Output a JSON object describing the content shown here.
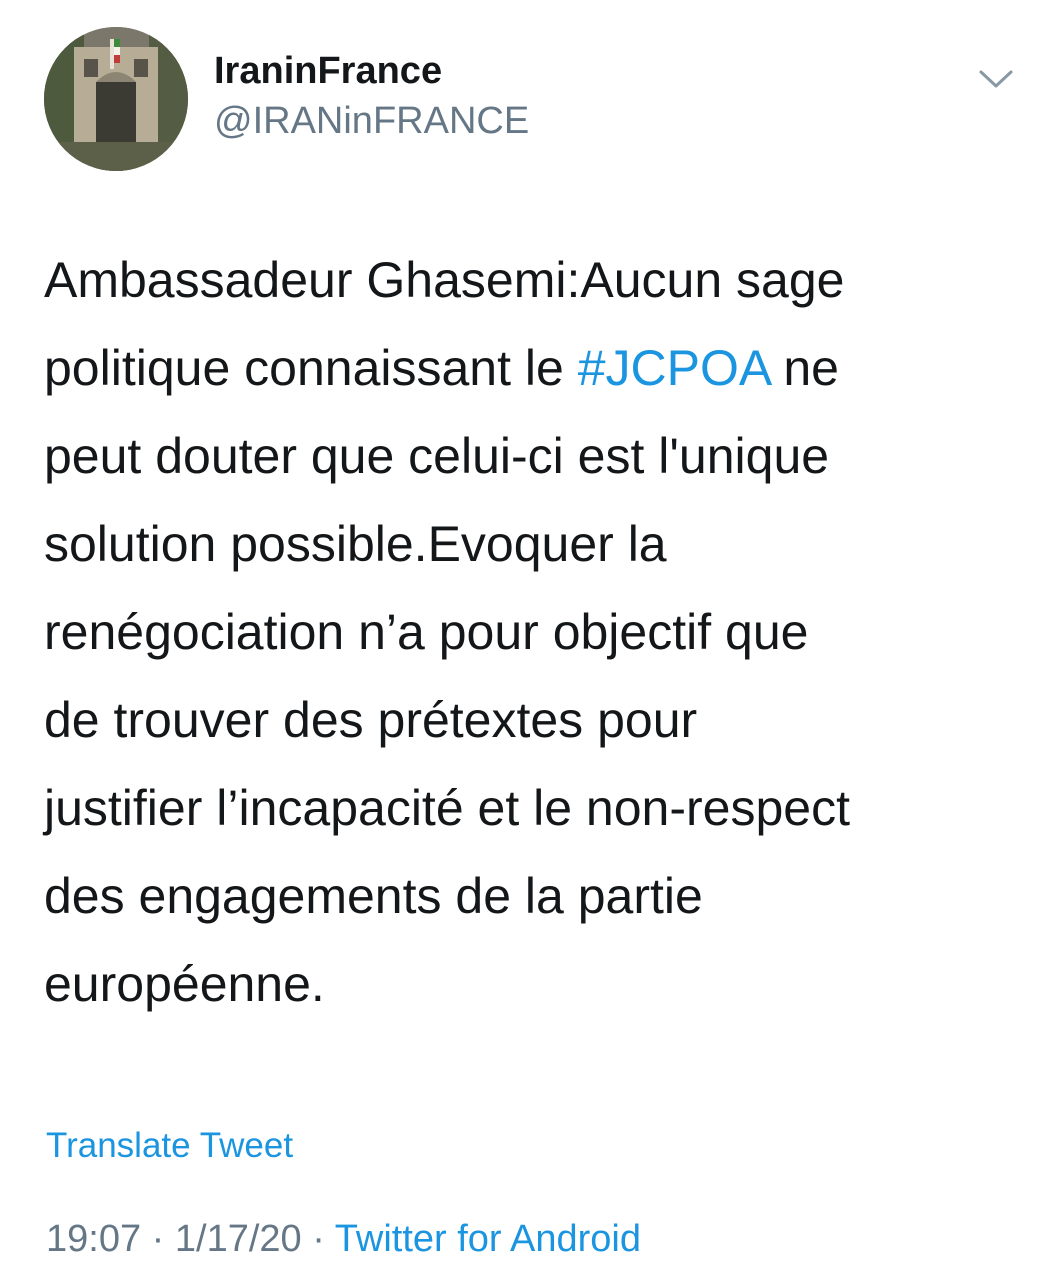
{
  "author": {
    "display_name": "IraninFrance",
    "handle": "@IRANinFRANCE",
    "avatar_icon": "embassy-building-photo-avatar"
  },
  "menu": {
    "icon": "chevron-down-icon"
  },
  "tweet": {
    "lines": {
      "l1": "Ambassadeur Ghasemi:Aucun sage",
      "l2_before": "politique connaissant le ",
      "l2_hashtag": "#JCPOA",
      "l2_after": " ne",
      "l3": "peut douter que celui-ci est l'unique",
      "l4": "solution possible.Evoquer la",
      "l5": "renégociation n’a pour objectif que",
      "l6": "de trouver des prétextes pour",
      "l7": "justifier l’incapacité et le non-respect",
      "l8": "des engagements de la partie",
      "l9": "européenne."
    }
  },
  "translate_label": "Translate Tweet",
  "meta": {
    "time": "19:07",
    "separator": " · ",
    "date": "1/17/20",
    "source": "Twitter for Android"
  },
  "colors": {
    "link": "#1b95e0",
    "text": "#14171a",
    "secondary": "#657786"
  }
}
